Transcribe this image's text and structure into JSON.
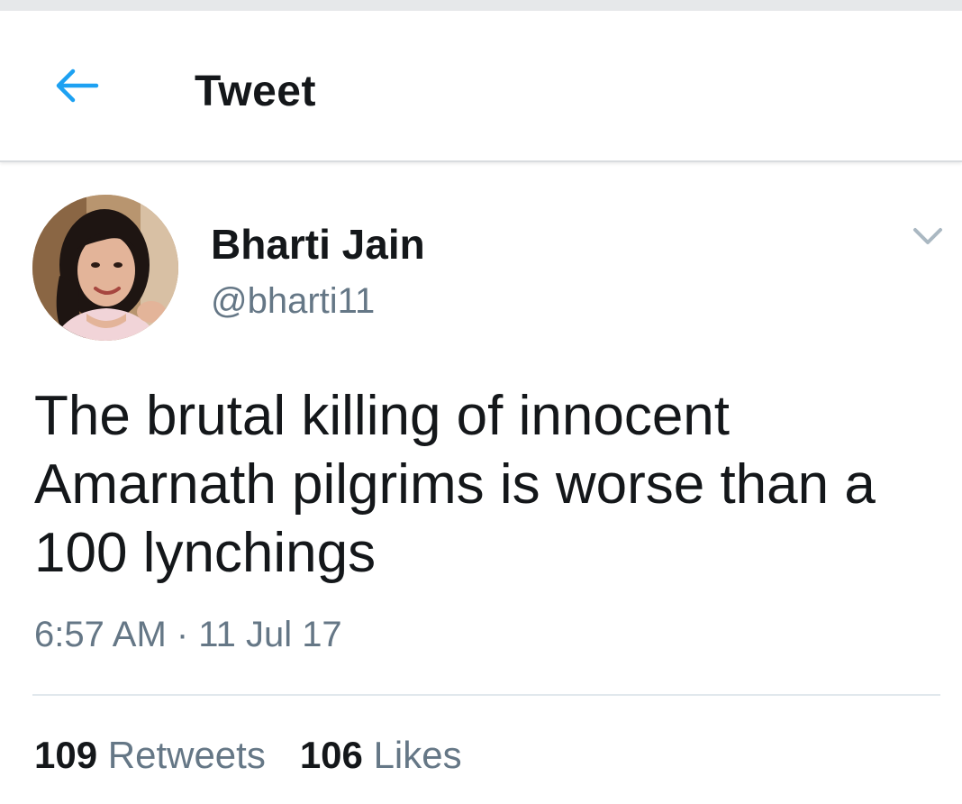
{
  "header": {
    "title": "Tweet",
    "back_icon": "arrow-left-icon",
    "accent_color": "#1da1f2"
  },
  "tweet": {
    "author": {
      "name": "Bharti Jain",
      "handle": "@bharti11"
    },
    "menu_icon": "chevron-down-icon",
    "text": "The brutal killing of innocent Amarnath pilgrims is worse than a 100 lynchings",
    "timestamp": "6:57 AM · 11 Jul 17",
    "stats": {
      "retweets_count": "109",
      "retweets_label": "Retweets",
      "likes_count": "106",
      "likes_label": "Likes"
    }
  }
}
